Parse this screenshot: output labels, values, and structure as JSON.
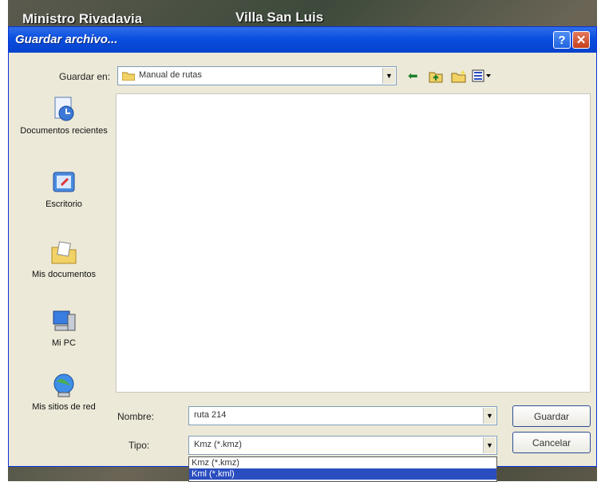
{
  "background": {
    "labels": [
      "Ministro Rivadavia",
      "Villa San Luis"
    ]
  },
  "dialog": {
    "title": "Guardar archivo...",
    "help_label": "?",
    "close_label": "✕"
  },
  "save_in": {
    "label": "Guardar en:",
    "value": "Manual de rutas"
  },
  "places": [
    {
      "label": "Documentos recientes",
      "icon": "recent-documents-icon"
    },
    {
      "label": "Escritorio",
      "icon": "desktop-icon"
    },
    {
      "label": "Mis documentos",
      "icon": "my-documents-icon"
    },
    {
      "label": "Mi PC",
      "icon": "my-computer-icon"
    },
    {
      "label": "Mis sitios de red",
      "icon": "network-places-icon"
    }
  ],
  "filename": {
    "label": "Nombre:",
    "value": "ruta 214"
  },
  "filetype": {
    "label": "Tipo:",
    "value": "Kmz (*.kmz)",
    "options": [
      "Kmz (*.kmz)",
      "Kml (*.kml)"
    ],
    "selected_index": 1
  },
  "buttons": {
    "save": "Guardar",
    "cancel": "Cancelar"
  },
  "colors": {
    "titlebar": "#0a4ee0",
    "dialog_bg": "#ece9d8",
    "selection": "#2a4dbf"
  }
}
